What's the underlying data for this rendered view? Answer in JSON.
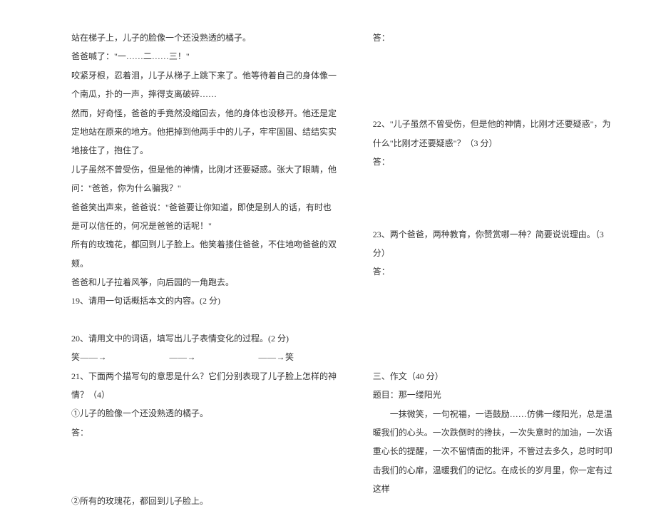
{
  "left": {
    "p1": "站在梯子上，儿子的脸像一个还没熟透的橘子。",
    "p2": "爸爸喊了：\"一……二……三！\"",
    "p3": "咬紧牙根，忍着泪，儿子从梯子上跳下来了。他等待着自己的身体像一个南瓜，扑的一声，摔得支离破碎……",
    "p4": "然而，好奇怪，爸爸的手竟然没缩回去，他的身体也没移开。他还是定定地站在原来的地方。他把掉到他两手中的儿子，牢牢固固、结结实实地接住了，抱住了。",
    "p5": "儿子虽然不曾受伤，但是他的神情，比刚才还要疑惑。张大了眼睛，他问：\"爸爸，你为什么骗我？\"",
    "p6": "爸爸笑出声来，爸爸说：\"爸爸要让你知道，即使是别人的话，有时也是可以信任的，何况是爸爸的话呢！\"",
    "p7": "所有的玫瑰花，都回到儿子脸上。他笑着搂住爸爸，不住地吻爸爸的双颊。",
    "p8": "爸爸和儿子拉着风筝，向后园的一角跑去。",
    "q19": "19、请用一句话概括本文的内容。(2 分)",
    "q20": "20、请用文中的词语，填写出儿子表情变化的过程。(2 分)",
    "q20_arrows": "笑——→　　　　　　　——→　　　　　　　——→笑",
    "q21": "21、下面两个描写句的意思是什么？它们分别表现了儿子脸上怎样的神情？（4）",
    "q21_a": "①儿子的脸像一个还没熟透的橘子。",
    "q21_ans": "答：",
    "q21_b": "②所有的玫瑰花，都回到儿子脸上。"
  },
  "right": {
    "ans": "答：",
    "q22": "22、\"儿子虽然不曾受伤，但是他的神情，比刚才还要疑惑\"，为什么\"比刚才还要疑惑\"？（3 分）",
    "q22_ans": "答：",
    "q23": "23、两个爸爸，两种教育，你赞赏哪一种？简要说说理由。（3 分）",
    "q23_ans": "答：",
    "section3": "三、作文（40 分）",
    "essay_title": "题目：那一缕阳光",
    "essay_prompt": "一抹微笑，一句祝福，一语鼓励……仿佛一缕阳光，总是温暖我们的心头。一次跌倒时的搀扶，一次失意时的加油，一次语重心长的提醒，一次不留情面的批评，不管过去多久，总时时叩击我们的心扉，温暖我们的记忆。在成长的岁月里，你一定有过这样"
  }
}
